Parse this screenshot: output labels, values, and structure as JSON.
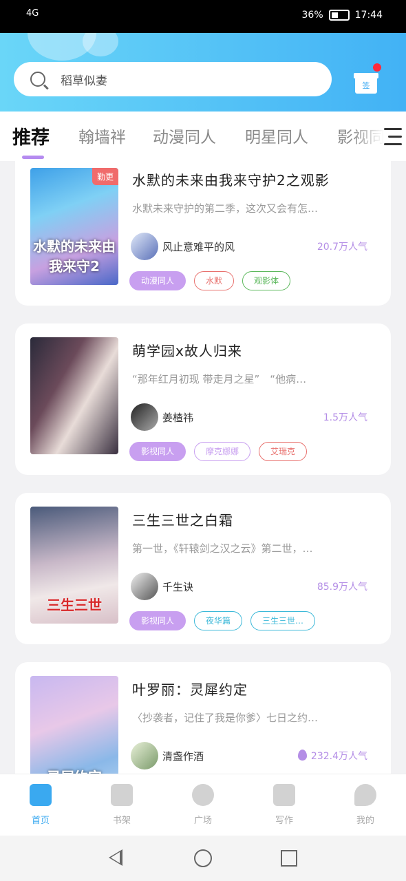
{
  "status": {
    "signal": "4G",
    "battery_text": "36%",
    "time": "17:44"
  },
  "search": {
    "placeholder": "稻草似妻"
  },
  "header": {
    "checkin_label": "签"
  },
  "tabs": [
    {
      "label": "推荐",
      "active": true
    },
    {
      "label": "翰墙袢",
      "active": false
    },
    {
      "label": "动漫同人",
      "active": false
    },
    {
      "label": "明星同人",
      "active": false
    },
    {
      "label": "影视同人",
      "active": false
    }
  ],
  "books": [
    {
      "title": "水默的未来由我来守护2之观影",
      "description": "水默未来守护的第二季，这次又会有怎…",
      "author": "风止意难平的风",
      "readers": "20.7万人气",
      "badge": "勤更",
      "cover_text": "水默的未来由我来守2",
      "tags": [
        {
          "label": "动漫同人",
          "style": "solid",
          "color": "#c89ff0"
        },
        {
          "label": "水默",
          "style": "outline",
          "color": "#e8706d"
        },
        {
          "label": "观影体",
          "style": "outline",
          "color": "#5cb85c"
        }
      ]
    },
    {
      "title": "萌学园x故人归来",
      "description": "“那年红月初现 带走月之星”　“他病…",
      "author": "姜楂祎",
      "readers": "1.5万人气",
      "badge": "",
      "cover_text": "",
      "tags": [
        {
          "label": "影视同人",
          "style": "solid",
          "color": "#c89ff0"
        },
        {
          "label": "摩克娜娜",
          "style": "outline",
          "color": "#c89ff0"
        },
        {
          "label": "艾瑞克",
          "style": "outline",
          "color": "#e8706d"
        }
      ]
    },
    {
      "title": "三生三世之白霜",
      "description": "第一世，《轩辕剑之汉之云》第二世，…",
      "author": "千生诀",
      "readers": "85.9万人气",
      "badge": "",
      "cover_text": "三生三世",
      "tags": [
        {
          "label": "影视同人",
          "style": "solid",
          "color": "#c89ff0"
        },
        {
          "label": "夜华篇",
          "style": "outline",
          "color": "#3bb8d8"
        },
        {
          "label": "三生三世…",
          "style": "outline",
          "color": "#3bb8d8"
        }
      ]
    },
    {
      "title": "叶罗丽：灵犀约定",
      "description": "〈抄袭者，记住了我是你爹〉七日之约…",
      "author": "清盏作酒",
      "readers": "232.4万人气",
      "badge": "",
      "cover_text": "灵犀约定",
      "tags": []
    }
  ],
  "bottom_nav": [
    {
      "label": "首页",
      "icon": "home-icon",
      "active": true
    },
    {
      "label": "书架",
      "icon": "bookshelf-icon",
      "active": false
    },
    {
      "label": "广场",
      "icon": "planet-icon",
      "active": false
    },
    {
      "label": "写作",
      "icon": "pen-icon",
      "active": false
    },
    {
      "label": "我的",
      "icon": "chat-bubble-icon",
      "active": false
    }
  ],
  "colors": {
    "accent": "#3aa9f0",
    "purple": "#b48ee6",
    "header_start": "#6ad6f8",
    "header_end": "#42b2f5"
  }
}
